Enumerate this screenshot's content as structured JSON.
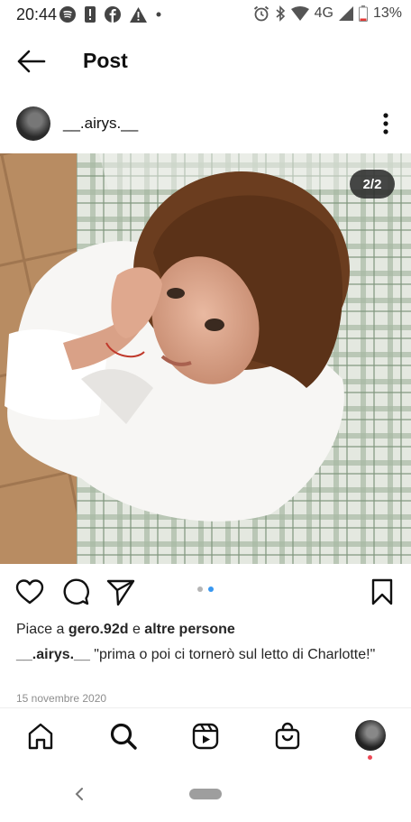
{
  "status_bar": {
    "time": "20:44",
    "network": "4G",
    "battery": "13%"
  },
  "header": {
    "title": "Post"
  },
  "post": {
    "username": "__.airys.__",
    "image_counter": "2/2",
    "carousel": {
      "count": 2,
      "active": 2
    },
    "likes": {
      "prefix": "Piace a ",
      "user": "gero.92d",
      "middle": " e ",
      "others": "altre persone"
    },
    "caption_user": "__.airys.__",
    "caption_text": " \"prima o poi ci tornerò sul letto di Charlotte!\"",
    "date": "15 novembre 2020"
  },
  "colors": {
    "accent_dot": "#3897f0",
    "notification_dot": "#ed4956"
  }
}
